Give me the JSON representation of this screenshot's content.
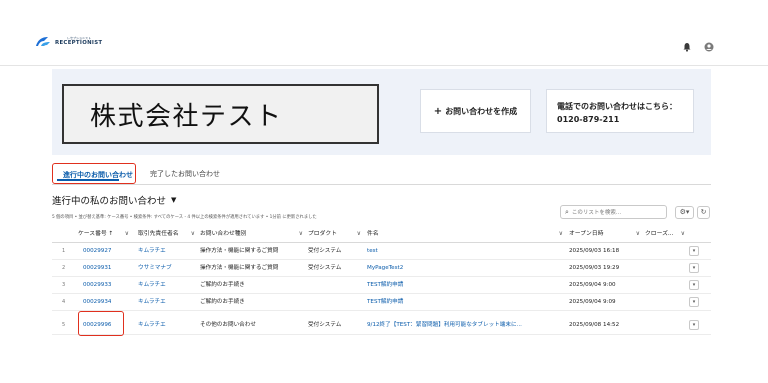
{
  "header": {
    "logo_text": "RECEPTIONIST",
    "logo_ruby": "レセプショニスト",
    "bell_icon": "bell-icon",
    "user_icon": "user-icon"
  },
  "banner": {
    "company_name": "株式会社テスト",
    "new_case_label": "お問い合わせを作成",
    "phone_line1": "電話でのお問い合わせはこちら：",
    "phone_line2": "0120-879-211"
  },
  "tabs": [
    {
      "label": "進行中のお問い合わせ",
      "active": true
    },
    {
      "label": "完了したお問い合わせ",
      "active": false
    }
  ],
  "list": {
    "title": "進行中の私のお問い合わせ",
    "meta": "5 個の項目 • 並び替え基準: ケース番号 • 検索条件: すべてのケース - 4 件以上の検索条件が適用されています • 1分前 に更新されました",
    "search_placeholder": "このリストを検索..."
  },
  "table": {
    "columns": [
      "ケース番号 ↑",
      "取引先責任者名",
      "お問い合わせ種別",
      "プロダクト",
      "件名",
      "オープン日時",
      "クローズ..."
    ],
    "rows": [
      {
        "num": "1",
        "case": "00029927",
        "contact": "キムラチエ",
        "type": "操作方法・機能に関するご質問",
        "product": "受付システム",
        "subject": "test",
        "opened": "2025/09/03 16:18"
      },
      {
        "num": "2",
        "case": "00029931",
        "contact": "ウサミマナブ",
        "type": "操作方法・機能に関するご質問",
        "product": "受付システム",
        "subject": "MyPageTest2",
        "opened": "2025/09/03 19:29"
      },
      {
        "num": "3",
        "case": "00029933",
        "contact": "キムラチエ",
        "type": "ご解約のお手続き",
        "product": "",
        "subject": "TEST解約申請",
        "opened": "2025/09/04 9:00"
      },
      {
        "num": "4",
        "case": "00029934",
        "contact": "キムラチエ",
        "type": "ご解約のお手続き",
        "product": "",
        "subject": "TEST解約申請",
        "opened": "2025/09/04 9:09"
      },
      {
        "num": "5",
        "case": "00029996",
        "contact": "キムラチエ",
        "type": "その他のお問い合わせ",
        "product": "受付システム",
        "subject": "9/12終了【TEST：緊習問題】利用可能なタブレット端末に...",
        "opened": "2025/09/08 14:52"
      }
    ]
  },
  "colors": {
    "link": "#0b5cab",
    "highlight": "#e0301e",
    "banner_bg": "#eef2f9"
  }
}
